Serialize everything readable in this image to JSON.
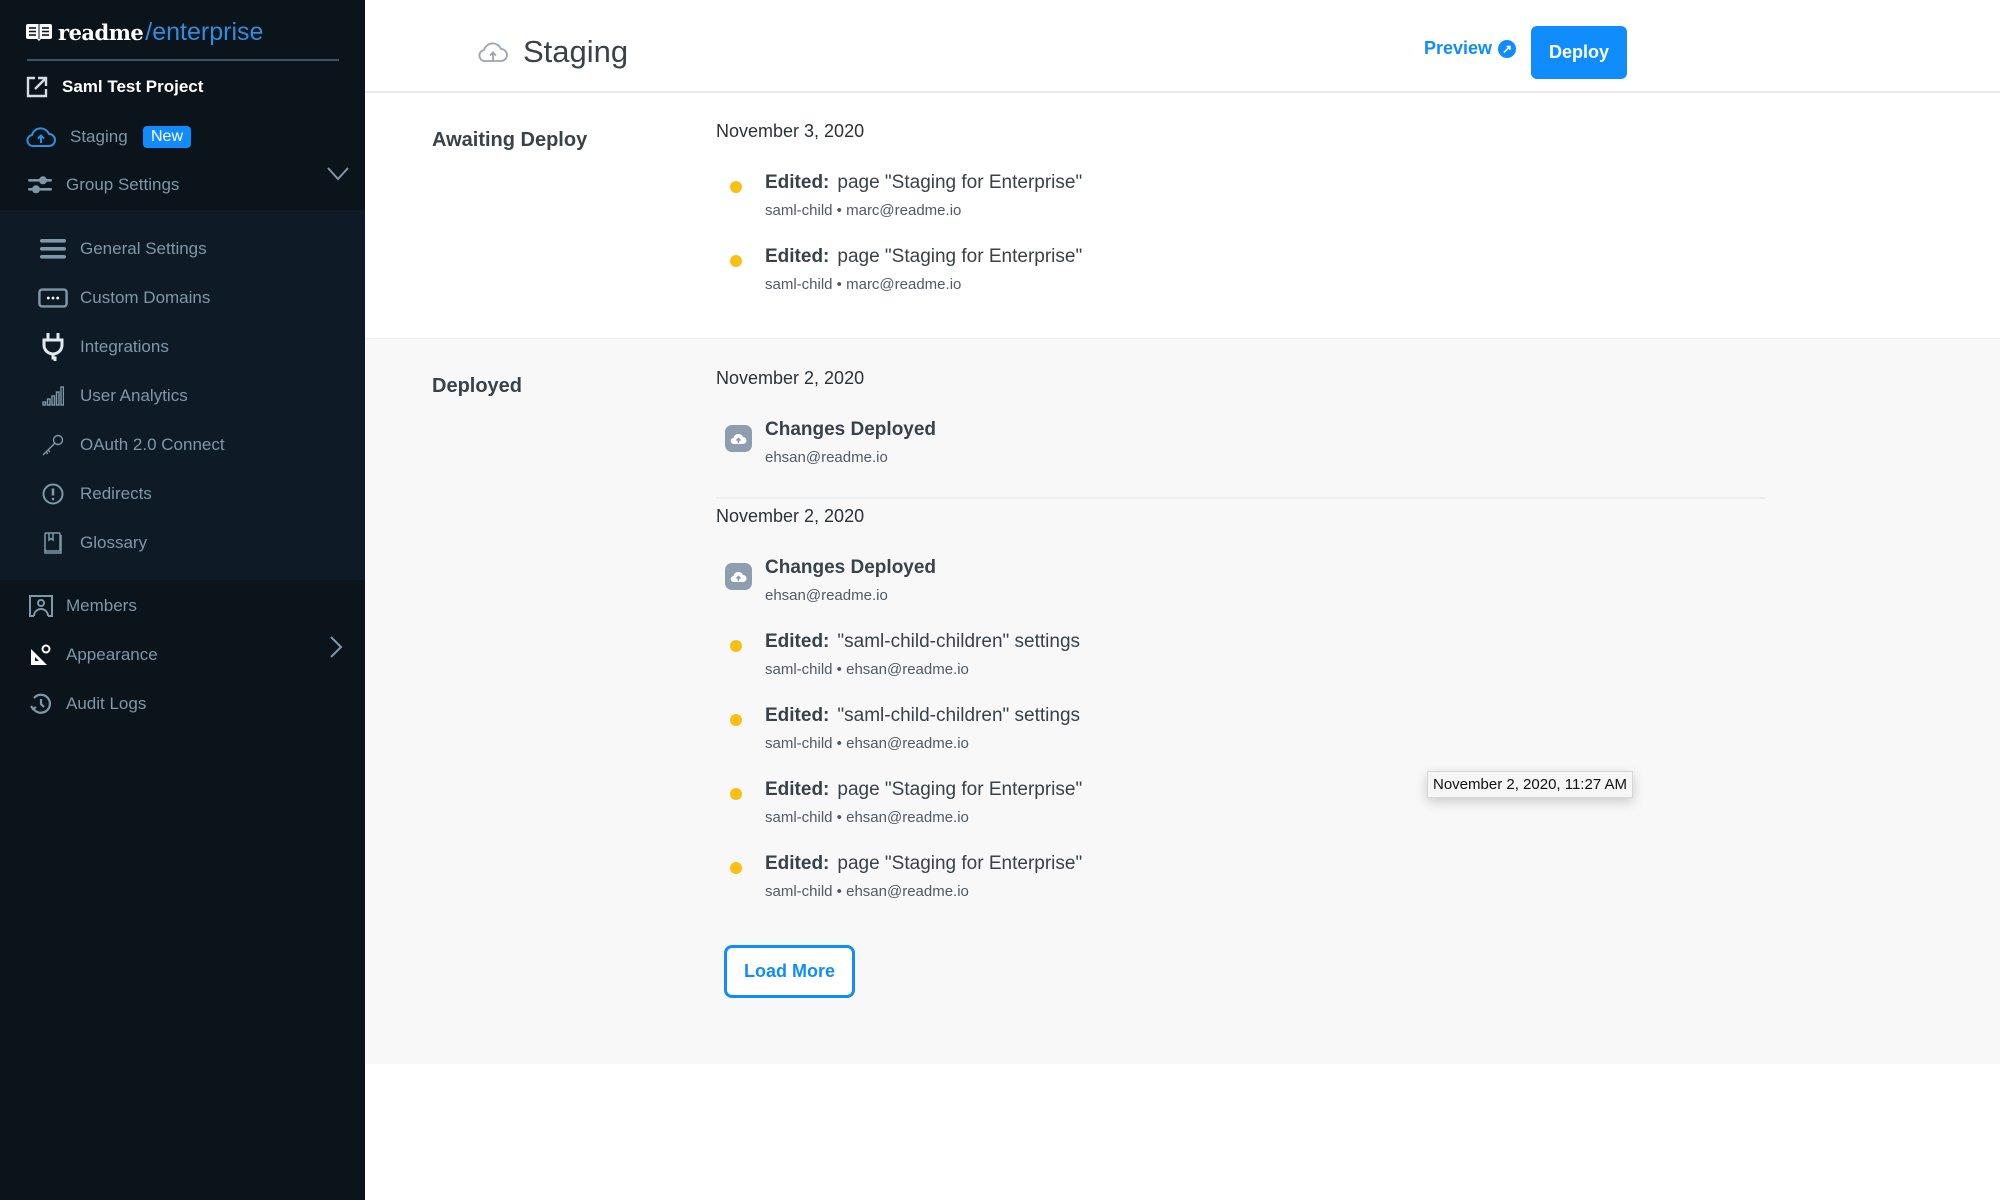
{
  "sidebar": {
    "logo": {
      "brand": "readme",
      "product": "/enterprise"
    },
    "project": "Saml Test Project",
    "staging": {
      "label": "Staging",
      "badge": "New"
    },
    "group_settings": {
      "label": "Group Settings",
      "expanded": true
    },
    "sub_items": [
      {
        "label": "General Settings",
        "icon": "menu-icon"
      },
      {
        "label": "Custom Domains",
        "icon": "domain-icon"
      },
      {
        "label": "Integrations",
        "icon": "plug-icon"
      },
      {
        "label": "User Analytics",
        "icon": "analytics-icon"
      },
      {
        "label": "OAuth 2.0 Connect",
        "icon": "key-icon"
      },
      {
        "label": "Redirects",
        "icon": "alert-icon"
      },
      {
        "label": "Glossary",
        "icon": "book-icon"
      }
    ],
    "items": [
      {
        "label": "Members",
        "icon": "members-icon"
      },
      {
        "label": "Appearance",
        "icon": "appearance-icon"
      },
      {
        "label": "Audit Logs",
        "icon": "history-icon"
      }
    ]
  },
  "header": {
    "title": "Staging",
    "preview_label": "Preview",
    "deploy_label": "Deploy"
  },
  "awaiting": {
    "label": "Awaiting Deploy",
    "date": "November 3, 2020",
    "items": [
      {
        "action": "Edited:",
        "text": "page \"Staging for Enterprise\"",
        "meta": "saml-child • marc@readme.io"
      },
      {
        "action": "Edited:",
        "text": "page \"Staging for Enterprise\"",
        "meta": "saml-child • marc@readme.io"
      }
    ]
  },
  "deployed": {
    "label": "Deployed",
    "groups": [
      {
        "date": "November 2, 2020",
        "deploy": {
          "title": "Changes Deployed",
          "meta": "ehsan@readme.io"
        }
      },
      {
        "date": "November 2, 2020",
        "deploy": {
          "title": "Changes Deployed",
          "meta": "ehsan@readme.io"
        },
        "items": [
          {
            "action": "Edited:",
            "text": "\"saml-child-children\" settings",
            "meta": "saml-child • ehsan@readme.io"
          },
          {
            "action": "Edited:",
            "text": "\"saml-child-children\" settings",
            "meta": "saml-child • ehsan@readme.io"
          },
          {
            "action": "Edited:",
            "text": "page \"Staging for Enterprise\"",
            "meta": "saml-child • ehsan@readme.io"
          },
          {
            "action": "Edited:",
            "text": "page \"Staging for Enterprise\"",
            "meta": "saml-child • ehsan@readme.io"
          }
        ]
      }
    ],
    "load_more_label": "Load More"
  },
  "tooltip": "November 2, 2020, 11:27 AM",
  "colors": {
    "accent": "#118cfd",
    "sidebar_bg": "#0b131b",
    "edit_dot": "#fbbf12",
    "deployed_bg": "#f8f8f8"
  }
}
